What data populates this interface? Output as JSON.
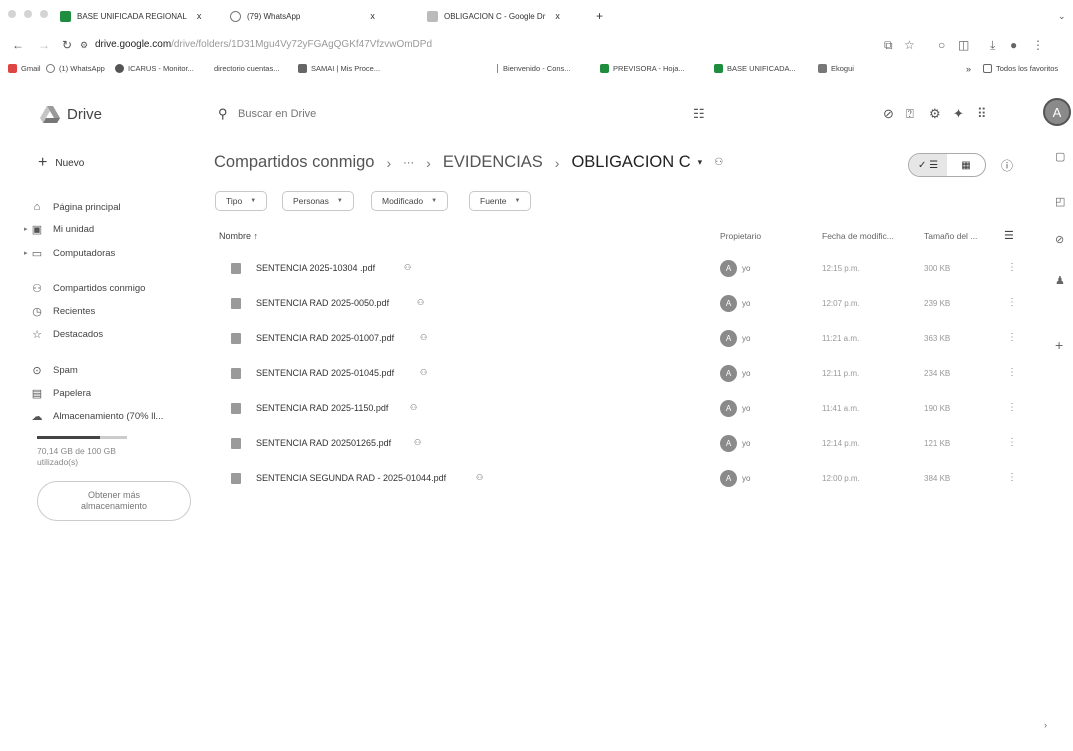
{
  "browser": {
    "tabs": [
      {
        "title": "BASE UNIFICADA REGIONAL",
        "close": "x"
      },
      {
        "title": "(79) WhatsApp",
        "close": "x"
      },
      {
        "title": "OBLIGACION C - Google Dr",
        "close": "x"
      }
    ],
    "new_tab": "+",
    "url_domain": "drive.google.com",
    "url_path": "/drive/folders/1D31Mgu4Vy72yFGAgQGKf47VfzvwOmDPd",
    "bookmarks": [
      "Gmail",
      "(1) WhatsApp",
      "ICARUS - Monitor...",
      "directorio cuentas...",
      "SAMAI | Mis Proce...",
      "Bienvenido - Cons...",
      "PREVISORA - Hoja...",
      "BASE UNIFICADA...",
      "Ekogui"
    ],
    "bookmarks_overflow": "»",
    "all_favorites": "Todos los favoritos"
  },
  "drive": {
    "title": "Drive",
    "search_placeholder": "Buscar en Drive",
    "avatar": "A",
    "new_label": "Nuevo",
    "nav": [
      {
        "label": "Página principal",
        "icon": "home-icon"
      },
      {
        "label": "Mi unidad",
        "icon": "my-drive-icon"
      },
      {
        "label": "Computadoras",
        "icon": "computer-icon"
      },
      {
        "label": "Compartidos conmigo",
        "icon": "shared-icon"
      },
      {
        "label": "Recientes",
        "icon": "clock-icon"
      },
      {
        "label": "Destacados",
        "icon": "star-icon"
      },
      {
        "label": "Spam",
        "icon": "spam-icon"
      },
      {
        "label": "Papelera",
        "icon": "trash-icon"
      },
      {
        "label": "Almacenamiento (70% ll...",
        "icon": "cloud-icon"
      }
    ],
    "storage_used_fraction": 0.7,
    "storage_text": "70,14 GB de 100 GB utilizado(s)",
    "more_storage": "Obtener más almacenamiento"
  },
  "breadcrumb": {
    "root": "Compartidos conmigo",
    "ellipsis": "···",
    "parent": "EVIDENCIAS",
    "current": "OBLIGACION C",
    "current_caret": "▾"
  },
  "filters": [
    "Tipo",
    "Personas",
    "Modificado",
    "Fuente"
  ],
  "columns": {
    "name": "Nombre",
    "owner": "Propietario",
    "modified": "Fecha de modific...",
    "size": "Tamaño del ..."
  },
  "files": [
    {
      "name": "SENTENCIA 2025-10304 .pdf",
      "owner": "yo",
      "avatar": "A",
      "date": "12:15 p.m.",
      "size": "300 KB"
    },
    {
      "name": "SENTENCIA RAD 2025-0050.pdf",
      "owner": "yo",
      "avatar": "A",
      "date": "12:07 p.m.",
      "size": "239 KB"
    },
    {
      "name": "SENTENCIA RAD 2025-01007.pdf",
      "owner": "yo",
      "avatar": "A",
      "date": "11:21 a.m.",
      "size": "363 KB"
    },
    {
      "name": "SENTENCIA RAD 2025-01045.pdf",
      "owner": "yo",
      "avatar": "A",
      "date": "12:11 p.m.",
      "size": "234 KB"
    },
    {
      "name": "SENTENCIA RAD 2025-1150.pdf",
      "owner": "yo",
      "avatar": "A",
      "date": "11:41 a.m.",
      "size": "190 KB"
    },
    {
      "name": "SENTENCIA RAD 202501265.pdf",
      "owner": "yo",
      "avatar": "A",
      "date": "12:14 p.m.",
      "size": "121 KB"
    },
    {
      "name": "SENTENCIA SEGUNDA RAD - 2025-01044.pdf",
      "owner": "yo",
      "avatar": "A",
      "date": "12:00 p.m.",
      "size": "384 KB"
    }
  ]
}
